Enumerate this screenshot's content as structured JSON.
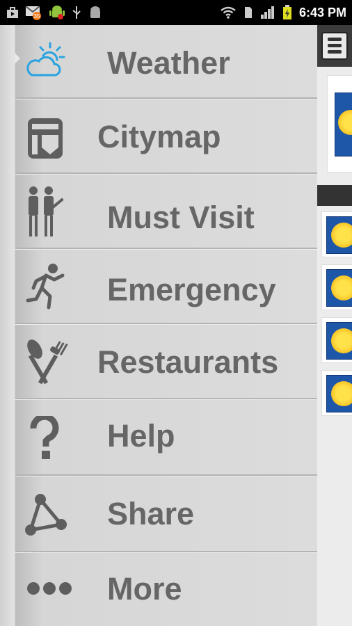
{
  "status_bar": {
    "time": "6:43 PM",
    "left_icons": [
      "briefcase-icon",
      "email-icon",
      "android-icon",
      "usb-icon",
      "android-debug-icon"
    ],
    "right_icons": [
      "wifi-icon",
      "sim-icon",
      "signal-icon",
      "battery-icon"
    ],
    "notification_badge": "35"
  },
  "menu": {
    "items": [
      {
        "label": "Weather",
        "icon": "weather-icon",
        "selected": true
      },
      {
        "label": "Citymap",
        "icon": "citymap-icon"
      },
      {
        "label": "Must Visit",
        "icon": "must-visit-icon"
      },
      {
        "label": "Emergency",
        "icon": "emergency-icon"
      },
      {
        "label": "Restaurants",
        "icon": "restaurants-icon"
      },
      {
        "label": "Help",
        "icon": "help-icon"
      },
      {
        "label": "Share",
        "icon": "share-icon"
      },
      {
        "label": "More",
        "icon": "more-icon"
      }
    ]
  },
  "colors": {
    "weather_icon": "#29a3e0",
    "menu_text": "#666666",
    "icon_gray": "#5e5e5e"
  }
}
